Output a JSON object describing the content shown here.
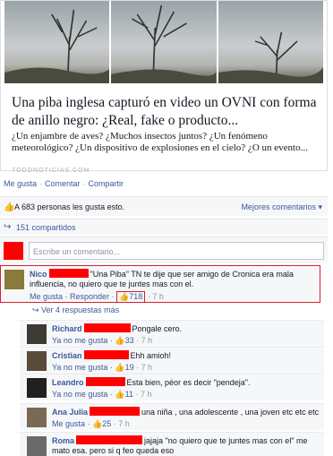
{
  "post": {
    "headline": "Una piba inglesa capturó en video un OVNI con forma de anillo negro: ¿Real, fake o producto...",
    "description": "¿Un enjambre de aves? ¿Muchos insectos juntos? ¿Un fenómeno meteorológico? ¿Un dispositivo de explosiones en el cielo? ¿O un evento...",
    "source": "TODONOTICIAS.COM"
  },
  "actions": {
    "like": "Me gusta",
    "comment": "Comentar",
    "share": "Compartir",
    "sep": "·"
  },
  "likes": {
    "text": "A 683 personas les gusta esto.",
    "sort": "Mejores comentarios ▾"
  },
  "shares": {
    "text": "151 compartidos"
  },
  "composer": {
    "placeholder": "Escribe un comentario..."
  },
  "top_comment": {
    "name": "Nico",
    "text": "\"Una Piba\" TN te dije que ser amigo de Cronica era mala influencia, no quiero que te juntes mas con el.",
    "like": "Me gusta",
    "reply": "Responder",
    "likes": "718",
    "time": "7 h"
  },
  "more_replies": "Ver 4 respuestas más",
  "replies": [
    {
      "name": "Richard",
      "text": "Pongale cero.",
      "like": "Ya no me gusta",
      "likes": "33",
      "time": "7 h"
    },
    {
      "name": "Cristian",
      "text": "Ehh amioh!",
      "like": "Ya no me gusta",
      "likes": "19",
      "time": "7 h"
    },
    {
      "name": "Leandro",
      "text": "Esta bien, péor es decir \"pendeja\".",
      "like": "Ya no me gusta",
      "likes": "11",
      "time": "7 h"
    },
    {
      "name": "Ana Julia",
      "text": "una niña , una adolescente , una joven etc etc etc",
      "like": "Me gusta",
      "likes": "25",
      "time": "7 h"
    },
    {
      "name": "Roma",
      "text": "jajaja \"no quiero que te juntes mas con el\" me mato esa. pero si q feo queda eso",
      "like": "",
      "likes": "",
      "time": ""
    }
  ]
}
